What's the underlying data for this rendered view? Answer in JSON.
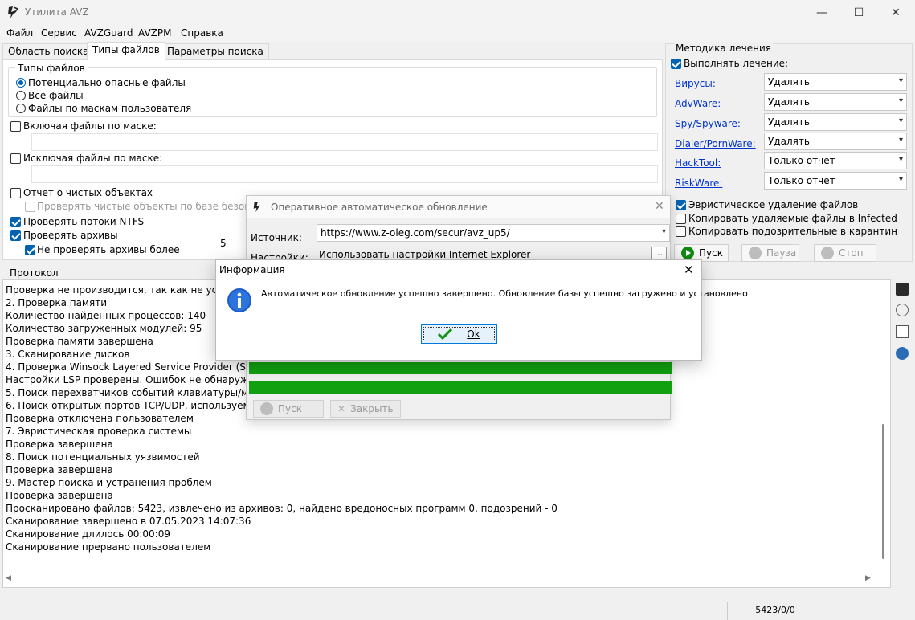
{
  "window": {
    "title": "Утилита AVZ",
    "minimize_glyph": "—",
    "maximize_glyph": "☐",
    "close_glyph": "✕"
  },
  "menu": [
    "Файл",
    "Сервис",
    "AVZGuard",
    "AVZPM",
    "Справка"
  ],
  "tabs": [
    "Область поиска",
    "Типы файлов",
    "Параметры поиска"
  ],
  "file_types": {
    "legend": "Типы файлов",
    "radios": [
      "Потенциально опасные файлы",
      "Все файлы",
      "Файлы по маскам пользователя"
    ],
    "include_mask": "Включая файлы по маске:",
    "exclude_mask": "Исключая файлы по маске:",
    "report_clean": "Отчет о чистых объектах",
    "check_clean_db": "Проверять чистые объекты по базе безопас",
    "check_ntfs": "Проверять потоки NTFS",
    "check_archives": "Проверять архивы",
    "skip_archives": "Не проверять архивы более",
    "archive_size": "5"
  },
  "cure": {
    "legend": "Методика лечения",
    "perform": "Выполнять лечение:",
    "rows": [
      {
        "link": "Вирусы:",
        "value": "Удалять"
      },
      {
        "link": "AdvWare:",
        "value": "Удалять"
      },
      {
        "link": "Spy/Spyware:",
        "value": "Удалять"
      },
      {
        "link": "Dialer/PornWare:",
        "value": "Удалять"
      },
      {
        "link": "HackTool:",
        "value": "Только отчет"
      },
      {
        "link": "RiskWare:",
        "value": "Только отчет"
      }
    ],
    "heuristic": "Эвристическое удаление файлов",
    "copy_deleted": "Копировать удаляемые файлы в  Infected",
    "copy_suspicious": "Копировать подозрительные в  карантин",
    "start": "Пуск",
    "pause": "Пауза",
    "stop": "Стоп"
  },
  "protocol": {
    "label": "Протокол",
    "lines": [
      "Проверка не производится, так как не устан",
      "2. Проверка памяти",
      " Количество найденных процессов: 140",
      " Количество загруженных модулей: 95",
      "Проверка памяти завершена",
      "3. Сканирование дисков",
      "4. Проверка Winsock Layered Service Provider (SPI/",
      " Настройки LSP проверены. Ошибок не обнаружен",
      "5. Поиск перехватчиков событий клавиатуры/мыш",
      "6. Поиск открытых портов TCP/UDP, используемых",
      " Проверка отключена пользователем",
      "7. Эвристическая проверка системы",
      "Проверка завершена",
      "8. Поиск потенциальных уязвимостей",
      "Проверка завершена",
      "9. Мастер поиска и устранения проблем",
      "Проверка завершена",
      "Просканировано файлов: 5423, извлечено из архивов: 0, найдено вредоносных программ 0, подозрений - 0",
      "Сканирование завершено в 07.05.2023 14:07:36",
      "Сканирование длилось 00:00:09",
      "Сканирование прервано пользователем"
    ]
  },
  "status": "5423/0/0",
  "update_dialog": {
    "title": "Оперативное автоматическое обновление",
    "source_label": "Источник:",
    "source_value": "https://www.z-oleg.com/secur/avz_up5/",
    "settings_label": "Настройки:",
    "settings_value": "Использовать настройки Internet Explorer",
    "browse": "...",
    "start": "Пуск",
    "close": "Закрыть",
    "progress": [
      1.0,
      1.0
    ]
  },
  "info_dialog": {
    "title": "Информация",
    "message": "Автоматическое обновление успешно завершено. Обновление базы успешно загружено и установлено",
    "ok": "Ok"
  },
  "colors": {
    "accent": "#0063b1",
    "link": "#0033cc",
    "progress": "#10a010"
  }
}
